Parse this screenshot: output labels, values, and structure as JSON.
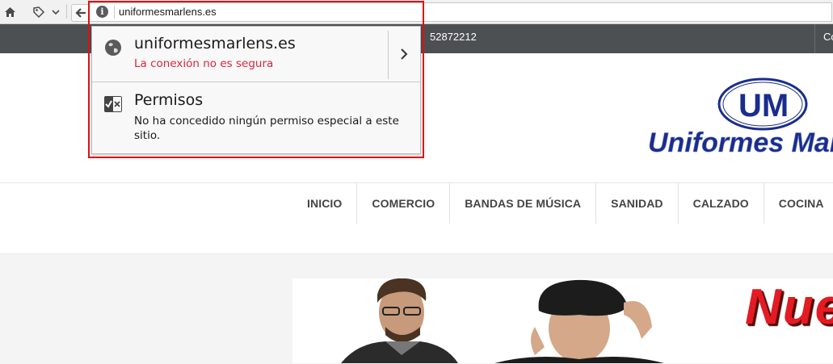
{
  "browser": {
    "url": "uniformesmarlens.es",
    "icons": [
      "home-icon",
      "bookmark-icon",
      "chevron-down-icon",
      "back-arrow-icon",
      "info-icon"
    ]
  },
  "site": {
    "topbar": {
      "phone": "52872212",
      "right_text": "Co"
    },
    "nav": [
      "INICIO",
      "COMERCIO",
      "BANDAS DE MÚSICA",
      "SANIDAD",
      "CALZADO",
      "COCINA"
    ],
    "logo": {
      "monogram": "UM",
      "name": "Uniformes Marl"
    },
    "banner_text": "Nue"
  },
  "popup": {
    "host": "uniformesmarlens.es",
    "security_status": "La conexión no es segura",
    "permissions_title": "Permisos",
    "permissions_desc": "No ha concedido ningún permiso especial a este sitio.",
    "colors": {
      "insecure": "#d7263d",
      "highlight": "#e01010"
    }
  }
}
